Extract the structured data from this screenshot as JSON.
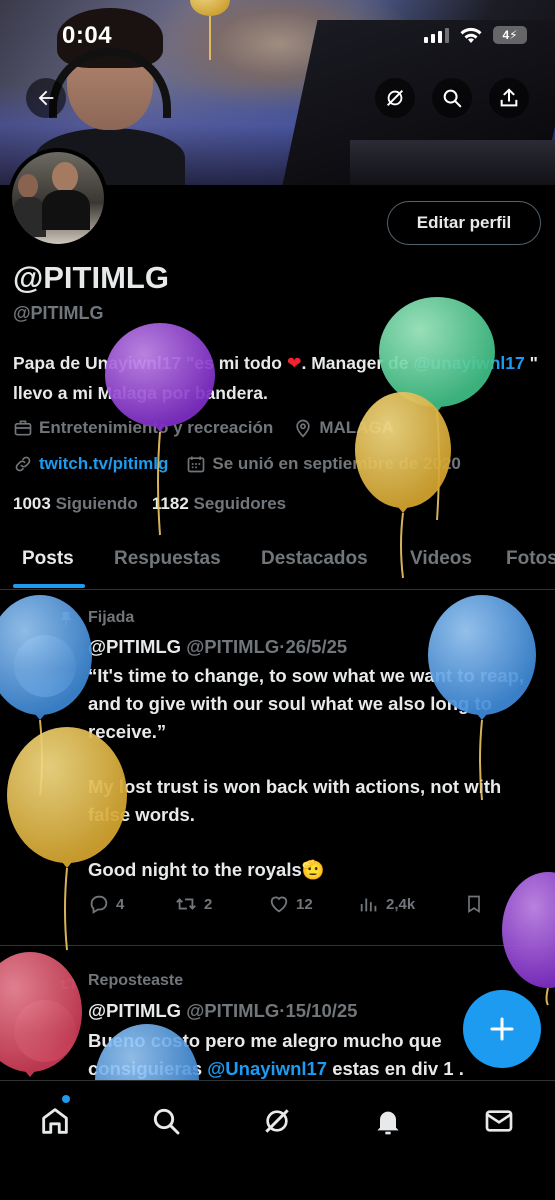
{
  "status_bar": {
    "time": "0:04",
    "battery": "4"
  },
  "profile": {
    "name": "@PITIMLG",
    "handle": "@PITIMLG",
    "edit_label": "Editar perfil",
    "bio": {
      "part1": "Papa de Unayiwnl17 \"es mi todo",
      "part2": ". Manager de ",
      "link": "@unayiwnl17",
      "part3": " \" llevo a mi Malaga por bandera."
    },
    "category": "Entretenimiento y recreación",
    "location": "MALAGA",
    "website": "twitch.tv/pitimlg",
    "joined": "Se unió en septiembre de 2020",
    "following_count": "1003",
    "following_label": "Siguiendo",
    "followers_count": "1182",
    "followers_label": "Seguidores"
  },
  "tabs": [
    "Posts",
    "Respuestas",
    "Destacados",
    "Videos",
    "Fotos"
  ],
  "pinned_tweet": {
    "label": "Fijada",
    "name": "@PITIMLG",
    "handle": "@PITIMLG",
    "dot": "·",
    "date": "26/5/25",
    "para1": "“It's time to change, to sow what we want to reap, and to give with our soul what we also long to receive.”",
    "para2": " My lost trust is won back with actions, not with false words.",
    "para3": "Good night to the royals",
    "emoji": "🫡",
    "replies": "4",
    "reposts": "2",
    "likes": "12",
    "views": "2,4k"
  },
  "repost_tweet": {
    "label": "Reposteaste",
    "name": "@PITIMLG",
    "handle": "@PITIMLG",
    "dot": "·",
    "date": "15/10/25",
    "text1": "Bueno costo pero me alegro mucho que",
    "text2": "consiguieras ",
    "link": "@Unayiwnl17",
    "text3": " estas en div 1 ."
  },
  "icons": {
    "back": "back-arrow-icon",
    "grok": "grok-icon",
    "search": "search-icon",
    "share": "share-icon",
    "home": "home-icon",
    "notifications": "bell-icon",
    "messages": "envelope-icon",
    "compose": "plus-icon"
  },
  "colors": {
    "accent": "#1d9bf0",
    "muted": "#71767b",
    "text": "#e7e9ea",
    "background": "#000000"
  }
}
